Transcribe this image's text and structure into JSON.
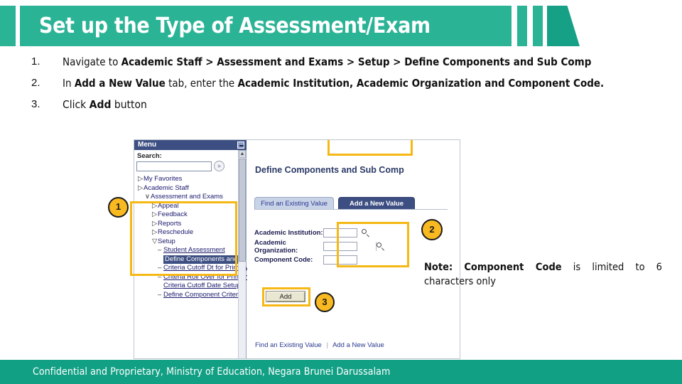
{
  "header": {
    "title": "Set up the Type of Assessment/Exam",
    "bar_color": "#2bb396",
    "trapezoid_color": "#16a085"
  },
  "bullets": [
    {
      "num": "1.",
      "parts": [
        {
          "t": "Navigate to ",
          "b": false
        },
        {
          "t": "Academic Staff > Assessment and Exams > Setup > Define Components and Sub Comp",
          "b": true
        }
      ]
    },
    {
      "num": "2.",
      "parts": [
        {
          "t": "In ",
          "b": false
        },
        {
          "t": "Add a New Value",
          "b": true
        },
        {
          "t": " tab, enter the ",
          "b": false
        },
        {
          "t": "Academic Institution, Academic Organization and Component Code.",
          "b": true
        }
      ]
    },
    {
      "num": "3.",
      "parts": [
        {
          "t": "Click ",
          "b": false
        },
        {
          "t": "Add",
          "b": true
        },
        {
          "t": " button",
          "b": false
        }
      ]
    }
  ],
  "screenshot": {
    "menu": {
      "title": "Menu",
      "minimize_icon": "minimize-icon",
      "search_label": "Search:",
      "search_value": "",
      "search_go_icon": "double-chevron-right-icon",
      "tree": [
        {
          "label": "My Favorites",
          "indent": 1,
          "arrow": "▷",
          "sel": false,
          "link": false
        },
        {
          "label": "Academic Staff",
          "indent": 1,
          "arrow": "▷",
          "sel": false,
          "link": false
        },
        {
          "label": "Assessment and Exams",
          "indent": 2,
          "arrow": "∨",
          "sel": false,
          "link": false
        },
        {
          "label": "Appeal",
          "indent": 3,
          "arrow": "▷",
          "sel": false,
          "link": false
        },
        {
          "label": "Feedback",
          "indent": 3,
          "arrow": "▷",
          "sel": false,
          "link": false
        },
        {
          "label": "Reports",
          "indent": 3,
          "arrow": "▷",
          "sel": false,
          "link": false
        },
        {
          "label": "Reschedule",
          "indent": 3,
          "arrow": "▷",
          "sel": false,
          "link": false
        },
        {
          "label": "Setup",
          "indent": 3,
          "arrow": "▽",
          "sel": false,
          "link": false
        },
        {
          "label": "Student Assessment",
          "indent": 4,
          "arrow": "–",
          "sel": false,
          "link": true
        },
        {
          "label": "Define Components and Sub Comp",
          "indent": 4,
          "arrow": "",
          "sel": true,
          "link": false
        },
        {
          "label": "Criteria Cutoff Dt for Primary",
          "indent": 4,
          "arrow": "–",
          "sel": false,
          "link": true
        },
        {
          "label": "Criteria Roll Over for Primary",
          "indent": 4,
          "arrow": "–",
          "sel": false,
          "link": true
        },
        {
          "label": "Criteria Cutoff Date Setup",
          "indent": 4,
          "arrow": "",
          "sel": false,
          "link": true
        },
        {
          "label": "Define Component Criteria",
          "indent": 4,
          "arrow": "–",
          "sel": false,
          "link": true
        }
      ],
      "scroll_up_icon": "caret-up-icon"
    },
    "content": {
      "page_title": "Define Components and Sub Comp",
      "tabs": [
        {
          "label": "Find an Existing Value",
          "active": false
        },
        {
          "label": "Add a New Value",
          "active": true
        }
      ],
      "fields": [
        {
          "label": "Academic Institution:",
          "value": "",
          "lookup": true
        },
        {
          "label": "Academic Organization:",
          "value": "",
          "lookup": true
        },
        {
          "label": "Component Code:",
          "value": "",
          "lookup": false
        }
      ],
      "add_button": "Add",
      "bottom_links": [
        "Find an Existing Value",
        "Add a New Value"
      ]
    },
    "highlight_color": "#f5b814"
  },
  "callouts": [
    {
      "id": "1",
      "label": "1"
    },
    {
      "id": "2",
      "label": "2"
    },
    {
      "id": "3",
      "label": "3"
    }
  ],
  "note": {
    "parts": [
      {
        "t": "Note:",
        "b": true
      },
      {
        "t": " ",
        "b": false
      },
      {
        "t": "Component Code",
        "b": true
      },
      {
        "t": " is limited to 6 characters only",
        "b": false
      }
    ]
  },
  "footer": {
    "text": "Confidential and Proprietary, Ministry of Education, Negara Brunei Darussalam",
    "color": "#12a085"
  }
}
